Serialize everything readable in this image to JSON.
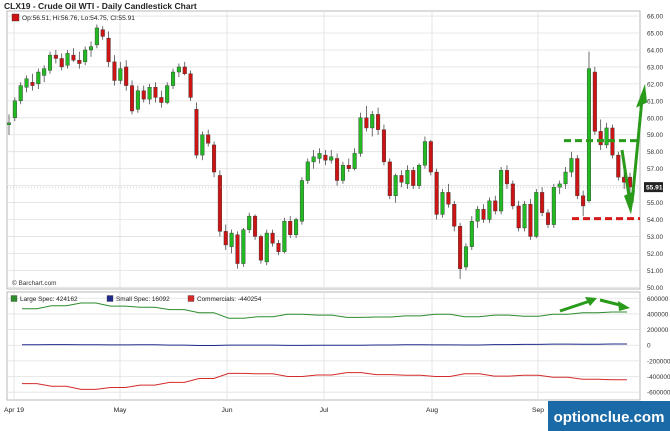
{
  "title": "CLX19 - Crude Oil WTI - Daily Candlestick Chart",
  "ohlc_legend": "Op:56.51, Hi:56.76, Lo:54.75, Cl:55.91",
  "credit": "© Barchart.com",
  "watermark": "optionclue.com",
  "last_price_label": "55.91",
  "colors": {
    "up": "#22b922",
    "down": "#cc1414",
    "grid": "#e0e0e0",
    "large": "#2e8b2e",
    "small": "#1f2a8a",
    "commercial": "#d42a2a",
    "annotation_up": "#2a9a1a",
    "annotation_down": "#d41a1a"
  },
  "chart_data": [
    {
      "type": "candlestick",
      "title": "CLX19 - Crude Oil WTI - Daily Candlestick Chart",
      "y_ticks": [
        "66.00",
        "65.00",
        "64.00",
        "63.00",
        "62.00",
        "61.00",
        "60.00",
        "59.00",
        "58.00",
        "57.00",
        "56.00",
        "55.00",
        "54.00",
        "53.00",
        "52.00",
        "51.00",
        "50.00"
      ],
      "x_ticks": [
        "Apr 19",
        "May",
        "Jun",
        "Jul",
        "Aug",
        "Sep"
      ],
      "ylim": [
        49.9,
        66.3
      ],
      "grid": true,
      "candles": [
        {
          "o": 59.6,
          "h": 60.2,
          "l": 59.0,
          "c": 59.7
        },
        {
          "o": 60.0,
          "h": 61.2,
          "l": 59.8,
          "c": 61.0
        },
        {
          "o": 61.0,
          "h": 62.1,
          "l": 60.8,
          "c": 61.9
        },
        {
          "o": 61.8,
          "h": 62.5,
          "l": 61.5,
          "c": 62.3
        },
        {
          "o": 62.1,
          "h": 62.6,
          "l": 61.6,
          "c": 61.9
        },
        {
          "o": 62.0,
          "h": 62.9,
          "l": 61.7,
          "c": 62.7
        },
        {
          "o": 62.5,
          "h": 63.1,
          "l": 62.1,
          "c": 62.9
        },
        {
          "o": 62.8,
          "h": 63.9,
          "l": 62.6,
          "c": 63.7
        },
        {
          "o": 63.7,
          "h": 64.0,
          "l": 63.2,
          "c": 63.5
        },
        {
          "o": 63.5,
          "h": 63.8,
          "l": 62.8,
          "c": 63.0
        },
        {
          "o": 63.1,
          "h": 64.0,
          "l": 62.9,
          "c": 63.8
        },
        {
          "o": 63.7,
          "h": 64.1,
          "l": 63.3,
          "c": 63.4
        },
        {
          "o": 63.4,
          "h": 63.9,
          "l": 62.9,
          "c": 63.2
        },
        {
          "o": 63.3,
          "h": 64.2,
          "l": 63.1,
          "c": 64.0
        },
        {
          "o": 64.0,
          "h": 64.5,
          "l": 63.6,
          "c": 64.2
        },
        {
          "o": 64.3,
          "h": 65.5,
          "l": 64.1,
          "c": 65.3
        },
        {
          "o": 65.2,
          "h": 65.4,
          "l": 64.6,
          "c": 64.8
        },
        {
          "o": 64.7,
          "h": 65.1,
          "l": 63.0,
          "c": 63.3
        },
        {
          "o": 63.3,
          "h": 63.7,
          "l": 61.9,
          "c": 62.2
        },
        {
          "o": 62.2,
          "h": 63.3,
          "l": 62.0,
          "c": 62.9
        },
        {
          "o": 63.0,
          "h": 63.4,
          "l": 61.6,
          "c": 61.9
        },
        {
          "o": 61.9,
          "h": 62.2,
          "l": 60.2,
          "c": 60.4
        },
        {
          "o": 60.5,
          "h": 61.9,
          "l": 60.3,
          "c": 61.6
        },
        {
          "o": 61.6,
          "h": 61.9,
          "l": 60.9,
          "c": 61.1
        },
        {
          "o": 61.1,
          "h": 62.0,
          "l": 60.8,
          "c": 61.8
        },
        {
          "o": 61.8,
          "h": 62.1,
          "l": 60.9,
          "c": 61.2
        },
        {
          "o": 61.2,
          "h": 61.6,
          "l": 60.6,
          "c": 60.9
        },
        {
          "o": 60.9,
          "h": 62.1,
          "l": 60.8,
          "c": 61.9
        },
        {
          "o": 61.9,
          "h": 62.9,
          "l": 61.7,
          "c": 62.7
        },
        {
          "o": 62.7,
          "h": 63.2,
          "l": 62.4,
          "c": 63.0
        },
        {
          "o": 63.0,
          "h": 63.3,
          "l": 62.5,
          "c": 62.6
        },
        {
          "o": 62.6,
          "h": 62.8,
          "l": 61.0,
          "c": 61.2
        },
        {
          "o": 60.5,
          "h": 60.9,
          "l": 57.6,
          "c": 57.8
        },
        {
          "o": 57.8,
          "h": 59.2,
          "l": 57.5,
          "c": 59.0
        },
        {
          "o": 59.0,
          "h": 59.3,
          "l": 58.3,
          "c": 58.5
        },
        {
          "o": 58.4,
          "h": 58.6,
          "l": 56.5,
          "c": 56.8
        },
        {
          "o": 56.6,
          "h": 56.9,
          "l": 53.0,
          "c": 53.3
        },
        {
          "o": 53.3,
          "h": 53.7,
          "l": 52.2,
          "c": 52.5
        },
        {
          "o": 52.4,
          "h": 53.4,
          "l": 52.0,
          "c": 53.2
        },
        {
          "o": 53.1,
          "h": 53.3,
          "l": 51.1,
          "c": 51.4
        },
        {
          "o": 51.4,
          "h": 53.5,
          "l": 51.2,
          "c": 53.4
        },
        {
          "o": 53.4,
          "h": 54.4,
          "l": 53.2,
          "c": 54.2
        },
        {
          "o": 54.2,
          "h": 54.3,
          "l": 52.8,
          "c": 53.0
        },
        {
          "o": 53.0,
          "h": 53.1,
          "l": 51.4,
          "c": 51.6
        },
        {
          "o": 51.5,
          "h": 53.4,
          "l": 51.3,
          "c": 53.2
        },
        {
          "o": 53.2,
          "h": 53.4,
          "l": 52.4,
          "c": 52.6
        },
        {
          "o": 52.6,
          "h": 52.8,
          "l": 51.9,
          "c": 52.1
        },
        {
          "o": 52.1,
          "h": 54.1,
          "l": 52.0,
          "c": 53.9
        },
        {
          "o": 53.9,
          "h": 54.2,
          "l": 52.9,
          "c": 53.1
        },
        {
          "o": 53.1,
          "h": 54.1,
          "l": 52.9,
          "c": 54.0
        },
        {
          "o": 53.9,
          "h": 56.5,
          "l": 53.7,
          "c": 56.3
        },
        {
          "o": 56.3,
          "h": 57.6,
          "l": 56.1,
          "c": 57.4
        },
        {
          "o": 57.4,
          "h": 58.1,
          "l": 57.0,
          "c": 57.7
        },
        {
          "o": 57.6,
          "h": 58.2,
          "l": 57.3,
          "c": 57.9
        },
        {
          "o": 57.8,
          "h": 58.1,
          "l": 57.2,
          "c": 57.5
        },
        {
          "o": 57.5,
          "h": 58.1,
          "l": 57.3,
          "c": 57.7
        },
        {
          "o": 57.6,
          "h": 57.9,
          "l": 56.0,
          "c": 56.3
        },
        {
          "o": 56.3,
          "h": 57.4,
          "l": 56.1,
          "c": 57.2
        },
        {
          "o": 57.2,
          "h": 57.6,
          "l": 56.8,
          "c": 57.0
        },
        {
          "o": 57.0,
          "h": 58.2,
          "l": 56.9,
          "c": 57.9
        },
        {
          "o": 57.9,
          "h": 60.3,
          "l": 57.7,
          "c": 60.0
        },
        {
          "o": 60.0,
          "h": 60.7,
          "l": 59.2,
          "c": 59.4
        },
        {
          "o": 59.4,
          "h": 60.4,
          "l": 58.9,
          "c": 60.2
        },
        {
          "o": 60.2,
          "h": 60.6,
          "l": 59.0,
          "c": 59.3
        },
        {
          "o": 59.3,
          "h": 59.6,
          "l": 57.2,
          "c": 57.4
        },
        {
          "o": 57.4,
          "h": 57.6,
          "l": 55.2,
          "c": 55.4
        },
        {
          "o": 55.4,
          "h": 56.7,
          "l": 55.0,
          "c": 56.6
        },
        {
          "o": 56.6,
          "h": 56.9,
          "l": 55.9,
          "c": 56.2
        },
        {
          "o": 56.1,
          "h": 57.2,
          "l": 55.8,
          "c": 56.9
        },
        {
          "o": 56.9,
          "h": 57.1,
          "l": 55.8,
          "c": 56.0
        },
        {
          "o": 56.0,
          "h": 57.3,
          "l": 55.8,
          "c": 57.2
        },
        {
          "o": 57.2,
          "h": 58.9,
          "l": 57.0,
          "c": 58.6
        },
        {
          "o": 58.6,
          "h": 58.7,
          "l": 56.6,
          "c": 56.8
        },
        {
          "o": 56.8,
          "h": 57.0,
          "l": 54.0,
          "c": 54.3
        },
        {
          "o": 54.3,
          "h": 55.8,
          "l": 54.1,
          "c": 55.6
        },
        {
          "o": 55.6,
          "h": 56.1,
          "l": 54.7,
          "c": 54.9
        },
        {
          "o": 54.9,
          "h": 55.1,
          "l": 53.3,
          "c": 53.6
        },
        {
          "o": 53.6,
          "h": 53.8,
          "l": 50.5,
          "c": 51.1
        },
        {
          "o": 51.2,
          "h": 52.6,
          "l": 51.0,
          "c": 52.4
        },
        {
          "o": 52.4,
          "h": 54.2,
          "l": 52.2,
          "c": 53.9
        },
        {
          "o": 53.9,
          "h": 54.8,
          "l": 53.5,
          "c": 54.6
        },
        {
          "o": 54.6,
          "h": 54.9,
          "l": 53.8,
          "c": 54.0
        },
        {
          "o": 54.0,
          "h": 55.3,
          "l": 53.8,
          "c": 55.1
        },
        {
          "o": 55.1,
          "h": 55.4,
          "l": 54.3,
          "c": 54.5
        },
        {
          "o": 54.5,
          "h": 57.1,
          "l": 54.3,
          "c": 56.9
        },
        {
          "o": 56.9,
          "h": 57.2,
          "l": 55.8,
          "c": 56.1
        },
        {
          "o": 56.1,
          "h": 56.3,
          "l": 54.6,
          "c": 54.8
        },
        {
          "o": 54.8,
          "h": 55.1,
          "l": 53.3,
          "c": 53.5
        },
        {
          "o": 53.5,
          "h": 55.1,
          "l": 53.3,
          "c": 54.9
        },
        {
          "o": 54.9,
          "h": 55.2,
          "l": 52.8,
          "c": 53.0
        },
        {
          "o": 53.0,
          "h": 55.8,
          "l": 52.9,
          "c": 55.6
        },
        {
          "o": 55.6,
          "h": 55.9,
          "l": 54.2,
          "c": 54.4
        },
        {
          "o": 54.4,
          "h": 54.6,
          "l": 53.5,
          "c": 53.7
        },
        {
          "o": 53.7,
          "h": 56.1,
          "l": 53.5,
          "c": 55.9
        },
        {
          "o": 55.9,
          "h": 56.3,
          "l": 55.5,
          "c": 56.1
        },
        {
          "o": 56.1,
          "h": 57.1,
          "l": 55.8,
          "c": 56.8
        },
        {
          "o": 56.8,
          "h": 58.0,
          "l": 56.5,
          "c": 57.6
        },
        {
          "o": 57.6,
          "h": 57.8,
          "l": 55.2,
          "c": 55.4
        },
        {
          "o": 55.4,
          "h": 55.7,
          "l": 54.2,
          "c": 54.8
        },
        {
          "o": 55.1,
          "h": 63.9,
          "l": 55.0,
          "c": 62.9
        },
        {
          "o": 62.7,
          "h": 63.0,
          "l": 59.0,
          "c": 59.2
        },
        {
          "o": 59.2,
          "h": 59.9,
          "l": 58.1,
          "c": 58.4
        },
        {
          "o": 58.4,
          "h": 59.7,
          "l": 58.2,
          "c": 59.4
        },
        {
          "o": 59.4,
          "h": 59.6,
          "l": 57.6,
          "c": 57.8
        },
        {
          "o": 57.8,
          "h": 58.0,
          "l": 56.3,
          "c": 56.5
        },
        {
          "o": 56.5,
          "h": 56.9,
          "l": 55.8,
          "c": 56.2
        },
        {
          "o": 56.5,
          "h": 56.76,
          "l": 54.75,
          "c": 55.91
        }
      ]
    },
    {
      "type": "line",
      "title": "",
      "y_ticks": [
        "600000",
        "400000",
        "200000",
        "0",
        "-200000",
        "-400000",
        "-600000"
      ],
      "ylim": [
        -700000,
        680000
      ],
      "grid": true,
      "legend": "top-left",
      "series": [
        {
          "name": "Large Spec: 424162",
          "color": "#2e8b2e",
          "values": [
            465000,
            465000,
            505000,
            505000,
            540000,
            540000,
            500000,
            500000,
            485000,
            485000,
            455000,
            455000,
            415000,
            415000,
            345000,
            345000,
            365000,
            365000,
            395000,
            395000,
            385000,
            385000,
            355000,
            355000,
            360000,
            360000,
            375000,
            375000,
            395000,
            395000,
            365000,
            365000,
            385000,
            385000,
            370000,
            370000,
            395000,
            395000,
            415000,
            415000,
            425000,
            425000
          ]
        },
        {
          "name": "Small Spec: 16092",
          "color": "#1f2a8a",
          "values": [
            5000,
            5000,
            8000,
            8000,
            6000,
            6000,
            4000,
            4000,
            5000,
            5000,
            2000,
            2000,
            -3000,
            -3000,
            2000,
            2000,
            1000,
            1000,
            -2000,
            -2000,
            -1000,
            -1000,
            0,
            0,
            3000,
            3000,
            5000,
            5000,
            4000,
            4000,
            3000,
            3000,
            8000,
            8000,
            10000,
            10000,
            14000,
            14000,
            12000,
            12000,
            16092,
            16092
          ]
        },
        {
          "name": "Commercials: -440254",
          "color": "#d42a2a",
          "values": [
            -490000,
            -490000,
            -525000,
            -525000,
            -565000,
            -565000,
            -540000,
            -540000,
            -510000,
            -510000,
            -475000,
            -475000,
            -425000,
            -425000,
            -360000,
            -360000,
            -365000,
            -365000,
            -400000,
            -400000,
            -380000,
            -380000,
            -350000,
            -350000,
            -375000,
            -375000,
            -385000,
            -385000,
            -400000,
            -400000,
            -365000,
            -365000,
            -395000,
            -395000,
            -385000,
            -385000,
            -410000,
            -410000,
            -435000,
            -435000,
            -440254,
            -440254
          ]
        }
      ]
    }
  ]
}
